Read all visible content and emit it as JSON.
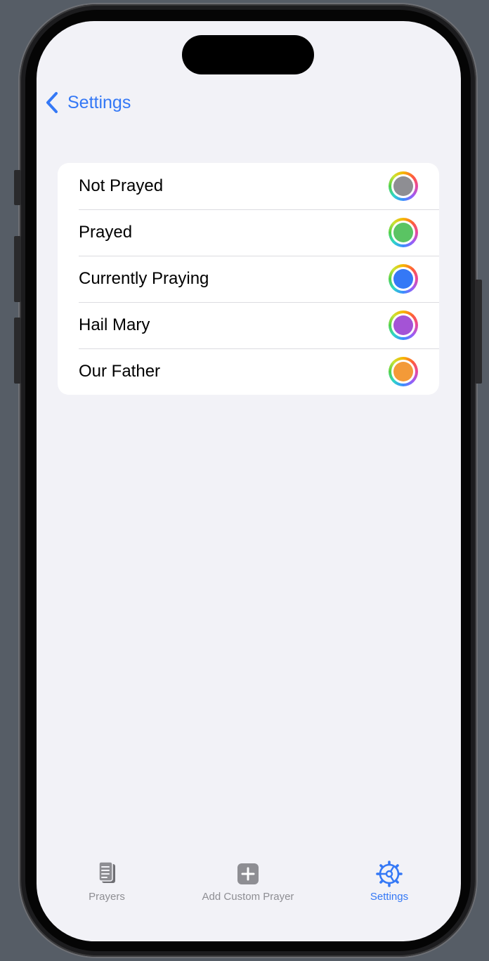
{
  "nav": {
    "back_label": "Settings"
  },
  "status_colors": [
    {
      "label": "Not Prayed",
      "color": "#8e8e93"
    },
    {
      "label": "Prayed",
      "color": "#5ac463"
    },
    {
      "label": "Currently Praying",
      "color": "#3478f6"
    },
    {
      "label": "Hail Mary",
      "color": "#a453d6"
    },
    {
      "label": "Our Father",
      "color": "#f39a38"
    }
  ],
  "tabs": [
    {
      "label": "Prayers",
      "icon": "document-icon",
      "active": false
    },
    {
      "label": "Add Custom Prayer",
      "icon": "plus-square-icon",
      "active": false
    },
    {
      "label": "Settings",
      "icon": "gear-icon",
      "active": true
    }
  ],
  "colors": {
    "accent": "#3478f6",
    "inactive": "#8e8e93",
    "background": "#f2f2f7"
  }
}
